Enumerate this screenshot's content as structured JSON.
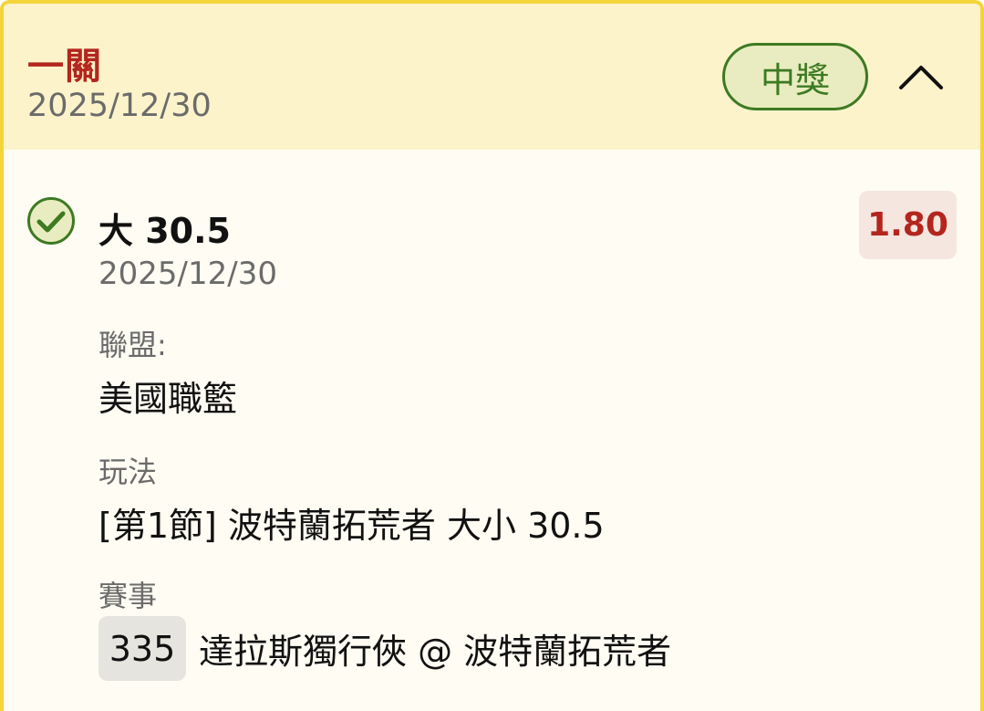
{
  "header": {
    "bet_type": "一關",
    "date": "2025/12/30",
    "status_label": "中獎",
    "collapse_icon": "chevron-up-icon"
  },
  "selection": {
    "status_icon": "check-circle-icon",
    "title": "大 30.5",
    "date": "2025/12/30",
    "odds": "1.80"
  },
  "details": {
    "league_label": "聯盟:",
    "league_value": "美國職籃",
    "market_label": "玩法",
    "market_value": "[第1節] 波特蘭拓荒者 大小 30.5",
    "event_label": "賽事",
    "event_id": "335",
    "event_name": "達拉斯獨行俠 @ 波特蘭拓荒者"
  },
  "colors": {
    "border_accent": "#f4d43a",
    "header_bg": "#fcf3cb",
    "card_bg": "#fefcf3",
    "win_green": "#3d7a22",
    "odds_red": "#b3261e"
  }
}
